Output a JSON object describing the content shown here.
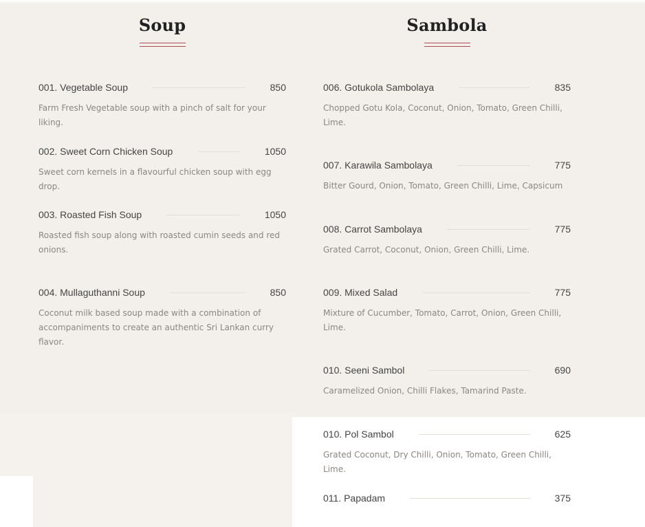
{
  "soup": {
    "title": "Soup",
    "items": [
      {
        "name": "001. Vegetable Soup",
        "price": "850",
        "desc": "Farm Fresh Vegetable soup with a pinch of salt for your liking."
      },
      {
        "name": "002. Sweet Corn Chicken Soup",
        "price": "1050",
        "desc": "Sweet corn kernels in a flavourful chicken soup with egg drop."
      },
      {
        "name": "003. Roasted Fish Soup",
        "price": "1050",
        "desc": "Roasted fish soup along with roasted cumin seeds and red onions."
      },
      {
        "name": "004. Mullaguthanni Soup",
        "price": "850",
        "desc": "Coconut milk based soup made with a combination of accompaniments to create an authentic Sri Lankan curry flavor."
      }
    ]
  },
  "sambola": {
    "title": "Sambola",
    "items": [
      {
        "name": "006. Gotukola Sambolaya",
        "price": "835",
        "desc": "Chopped Gotu Kola, Coconut, Onion, Tomato, Green Chilli, Lime."
      },
      {
        "name": "007. Karawila Sambolaya",
        "price": "775",
        "desc": "Bitter Gourd, Onion, Tomato, Green Chilli, Lime, Capsicum"
      },
      {
        "name": "008. Carrot Sambolaya",
        "price": "775",
        "desc": "Grated Carrot, Coconut, Onion, Green Chilli, Lime."
      },
      {
        "name": "009. Mixed Salad",
        "price": "775",
        "desc": "Mixture of Cucumber, Tomato, Carrot, Onion, Green Chilli, Lime."
      },
      {
        "name": "010. Seeni Sambol",
        "price": "690",
        "desc": "Caramelized Onion, Chilli Flakes, Tamarind Paste."
      },
      {
        "name": "010. Pol Sambol",
        "price": "625",
        "desc": "Grated Coconut, Dry Chilli, Onion, Tomato, Green Chilli, Lime."
      },
      {
        "name": "011. Papadam",
        "price": "375",
        "desc": ""
      }
    ]
  },
  "colors": {
    "background": "#f3f0eb",
    "accent_rule": "#b14a52",
    "text": "#444444",
    "muted": "#8a8680"
  }
}
